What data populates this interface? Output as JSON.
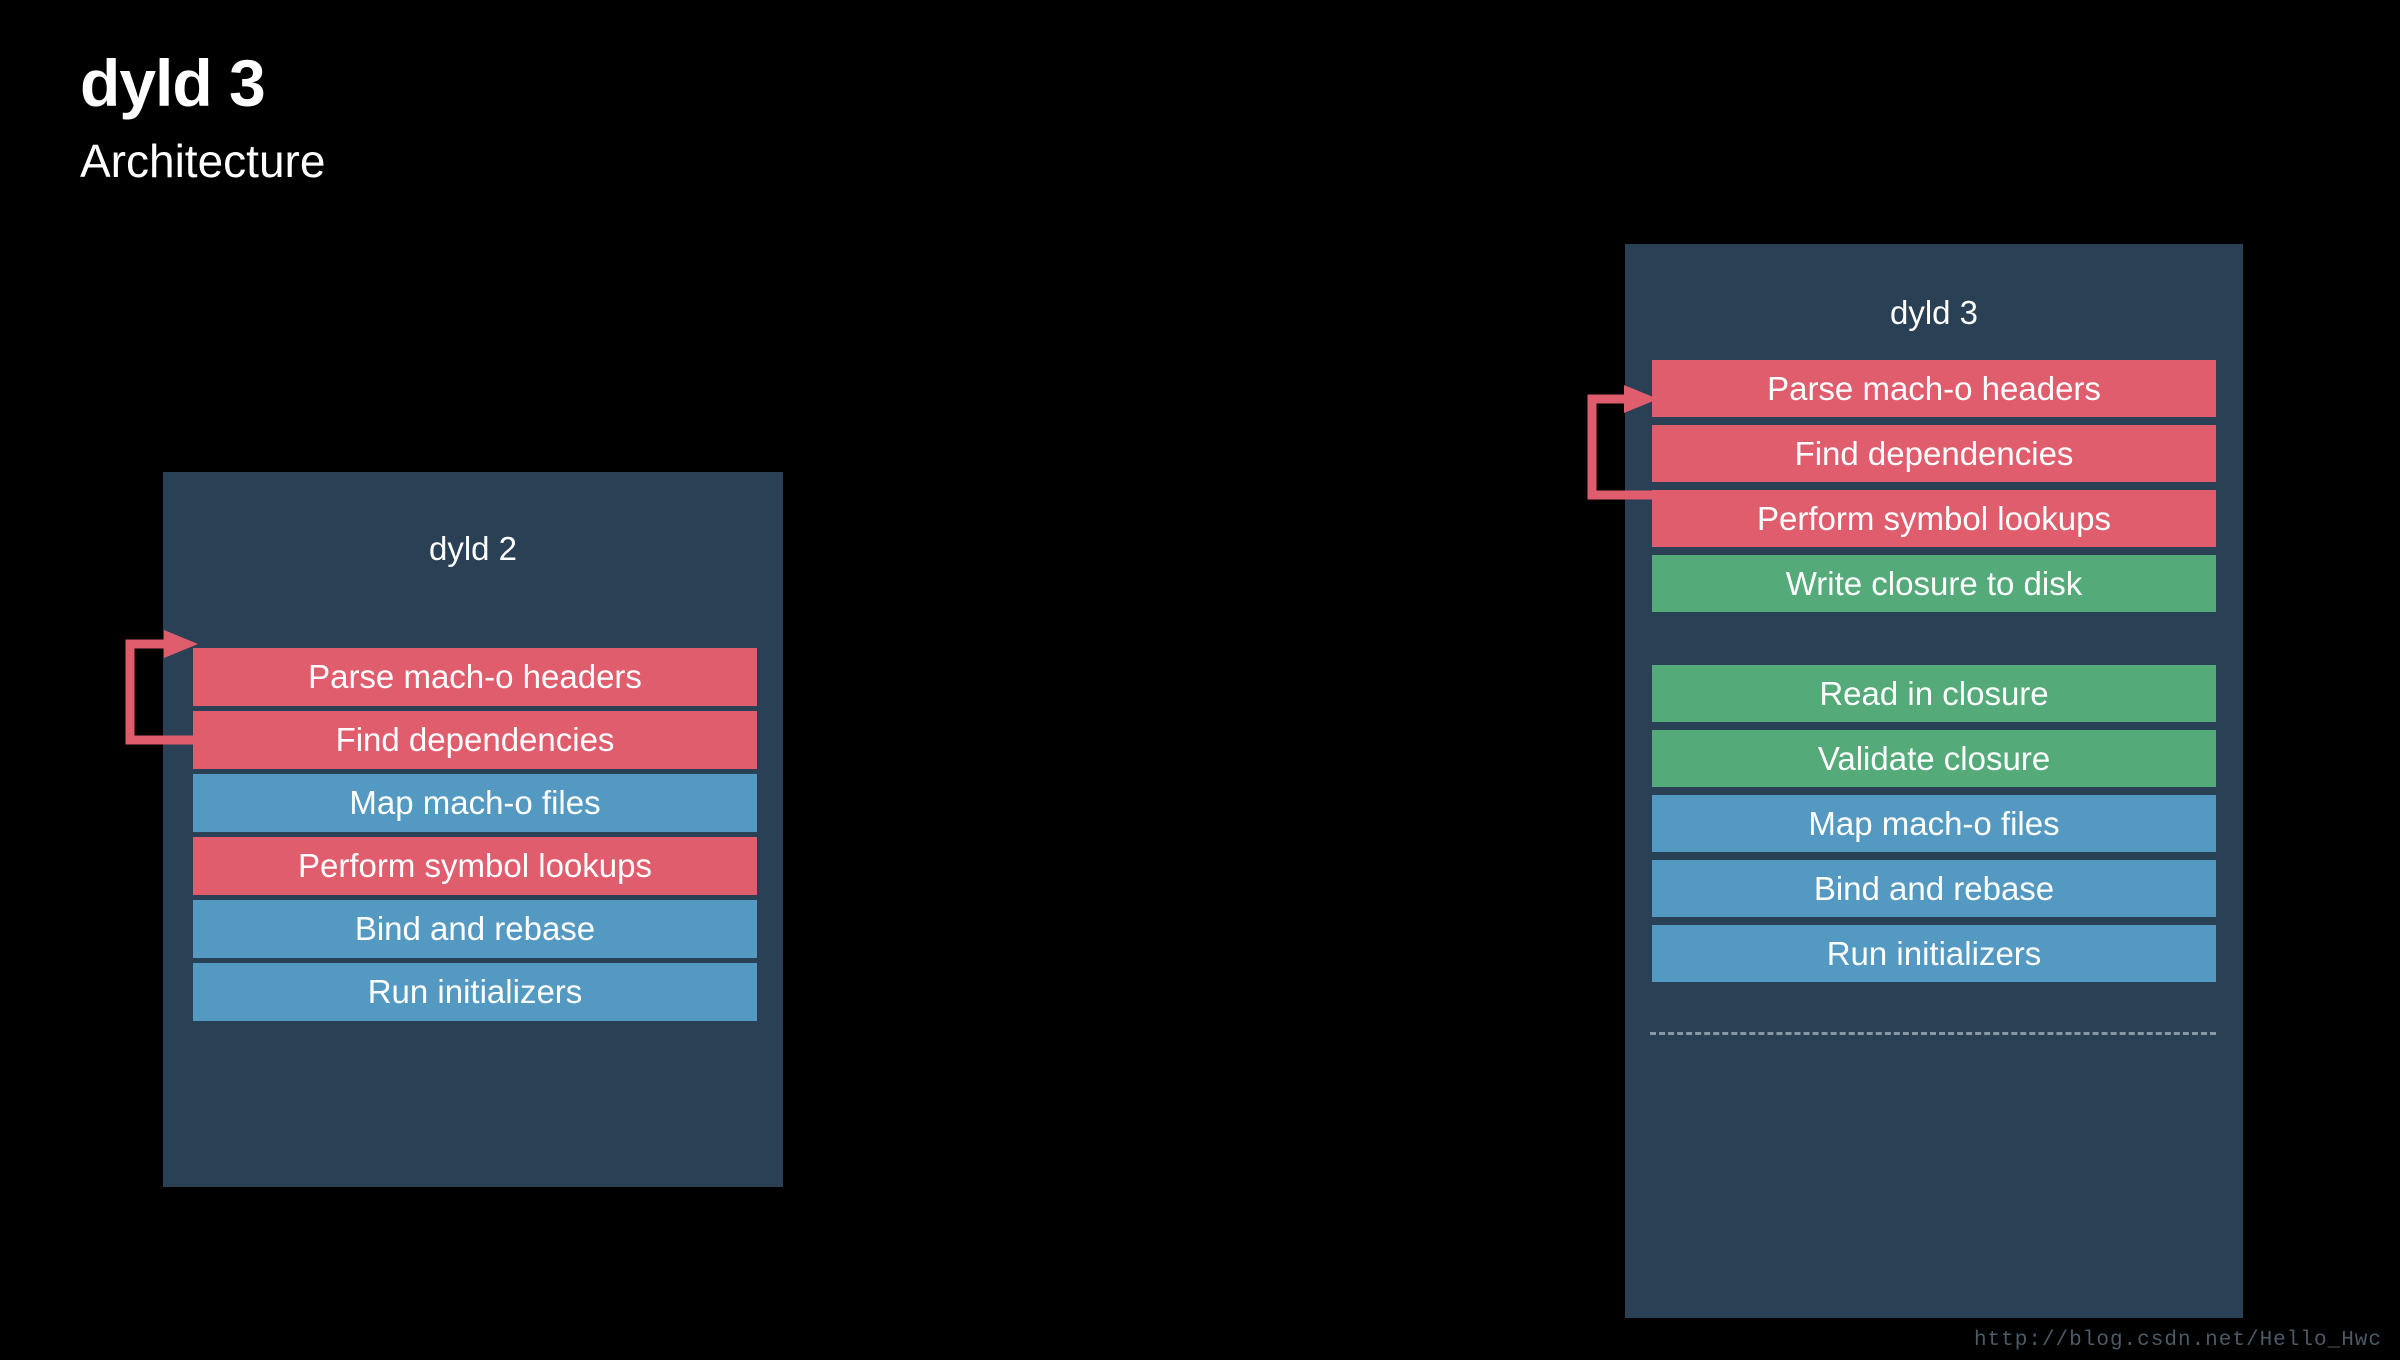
{
  "slide": {
    "title": "dyld 3",
    "subtitle": "Architecture",
    "background_color": "#000000",
    "watermark": "http://blog.csdn.net/Hello_Hwc"
  },
  "colors": {
    "panel": "#2a4055",
    "red": "#e05d6d",
    "blue": "#5499c2",
    "green": "#54ab79",
    "arrow": "#e05d6d",
    "divider": "#9aa7b0",
    "text": "#ffffff"
  },
  "diagrams": [
    {
      "id": "dyld2",
      "title": "dyld 2",
      "steps": [
        {
          "label": "Parse mach-o headers",
          "color": "red"
        },
        {
          "label": "Find dependencies",
          "color": "red"
        },
        {
          "label": "Map mach-o files",
          "color": "blue"
        },
        {
          "label": "Perform symbol lookups",
          "color": "red"
        },
        {
          "label": "Bind and rebase",
          "color": "blue"
        },
        {
          "label": "Run initializers",
          "color": "blue"
        }
      ],
      "loop": {
        "from_step": 1,
        "to_step": 0
      }
    },
    {
      "id": "dyld3",
      "title": "dyld 3",
      "steps": [
        {
          "label": "Parse mach-o headers",
          "color": "red"
        },
        {
          "label": "Find dependencies",
          "color": "red"
        },
        {
          "label": "Perform symbol lookups",
          "color": "red"
        },
        {
          "label": "Write closure to disk",
          "color": "green"
        },
        {
          "label": "Read in closure",
          "color": "green"
        },
        {
          "label": "Validate closure",
          "color": "green"
        },
        {
          "label": "Map mach-o files",
          "color": "blue"
        },
        {
          "label": "Bind and rebase",
          "color": "blue"
        },
        {
          "label": "Run initializers",
          "color": "blue"
        }
      ],
      "divider_after_step": 3,
      "loop": {
        "from_step": 1,
        "to_step": 0
      }
    }
  ]
}
